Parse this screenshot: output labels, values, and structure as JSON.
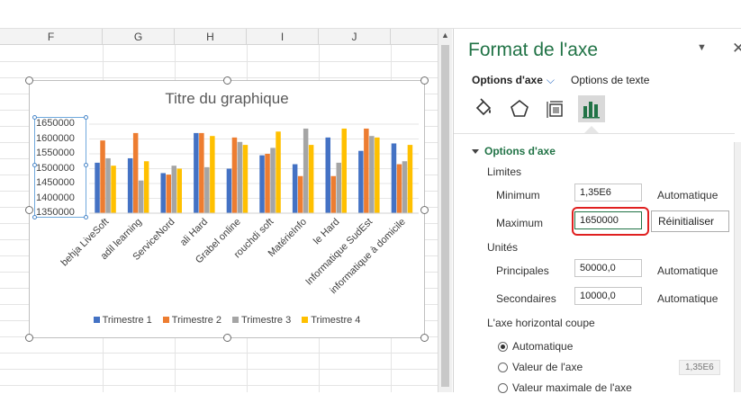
{
  "sheet": {
    "columns": [
      "F",
      "G",
      "H",
      "I",
      "J"
    ]
  },
  "chart": {
    "title": "Titre du graphique",
    "chart_data": {
      "type": "bar",
      "title": "Titre du graphique",
      "categories": [
        "behja LiveSoft",
        "adil learning",
        "ServiceNord",
        "ali Hard",
        "Grabel online",
        "rouchdi soft",
        "MatérieInfo",
        "le Hard",
        "Informatique SudEst",
        "informatique à domicile"
      ],
      "ylim": [
        1350000,
        1650000
      ],
      "yticks": [
        "1650000",
        "1600000",
        "1550000",
        "1500000",
        "1450000",
        "1400000",
        "1350000"
      ],
      "legend": "bottom",
      "series": [
        {
          "name": "Trimestre 1",
          "color": "#4472c4",
          "values": [
            1520000,
            1535000,
            1485000,
            1620000,
            1500000,
            1545000,
            1515000,
            1605000,
            1560000,
            1585000
          ]
        },
        {
          "name": "Trimestre 2",
          "color": "#ed7d31",
          "values": [
            1595000,
            1620000,
            1480000,
            1620000,
            1605000,
            1550000,
            1475000,
            1475000,
            1635000,
            1515000
          ]
        },
        {
          "name": "Trimestre 3",
          "color": "#a5a5a5",
          "values": [
            1535000,
            1460000,
            1510000,
            1505000,
            1590000,
            1570000,
            1635000,
            1520000,
            1610000,
            1525000
          ]
        },
        {
          "name": "Trimestre 4",
          "color": "#ffc000",
          "values": [
            1510000,
            1525000,
            1500000,
            1610000,
            1580000,
            1625000,
            1580000,
            1635000,
            1605000,
            1580000
          ]
        }
      ]
    }
  },
  "pane": {
    "title": "Format de l'axe",
    "tab_axis": "Options d'axe",
    "tab_text": "Options de texte",
    "icons": [
      "fill-bucket-icon",
      "pentagon-icon",
      "size-properties-icon",
      "bar-chart-icon"
    ],
    "section": "Options d'axe",
    "limits": "Limites",
    "min_label": "Minimum",
    "min_value": "1,35E6",
    "min_auto": "Automatique",
    "max_label": "Maximum",
    "max_value": "1650000",
    "reset": "Réinitialiser",
    "units": "Unités",
    "major_label": "Principales",
    "major_value": "50000,0",
    "major_auto": "Automatique",
    "minor_label": "Secondaires",
    "minor_value": "10000,0",
    "minor_auto": "Automatique",
    "cross_label": "L'axe horizontal coupe",
    "radio_auto": "Automatique",
    "radio_value": "Valeur de l'axe",
    "radio_value_field": "1,35E6",
    "radio_max": "Valeur maximale de l'axe"
  }
}
